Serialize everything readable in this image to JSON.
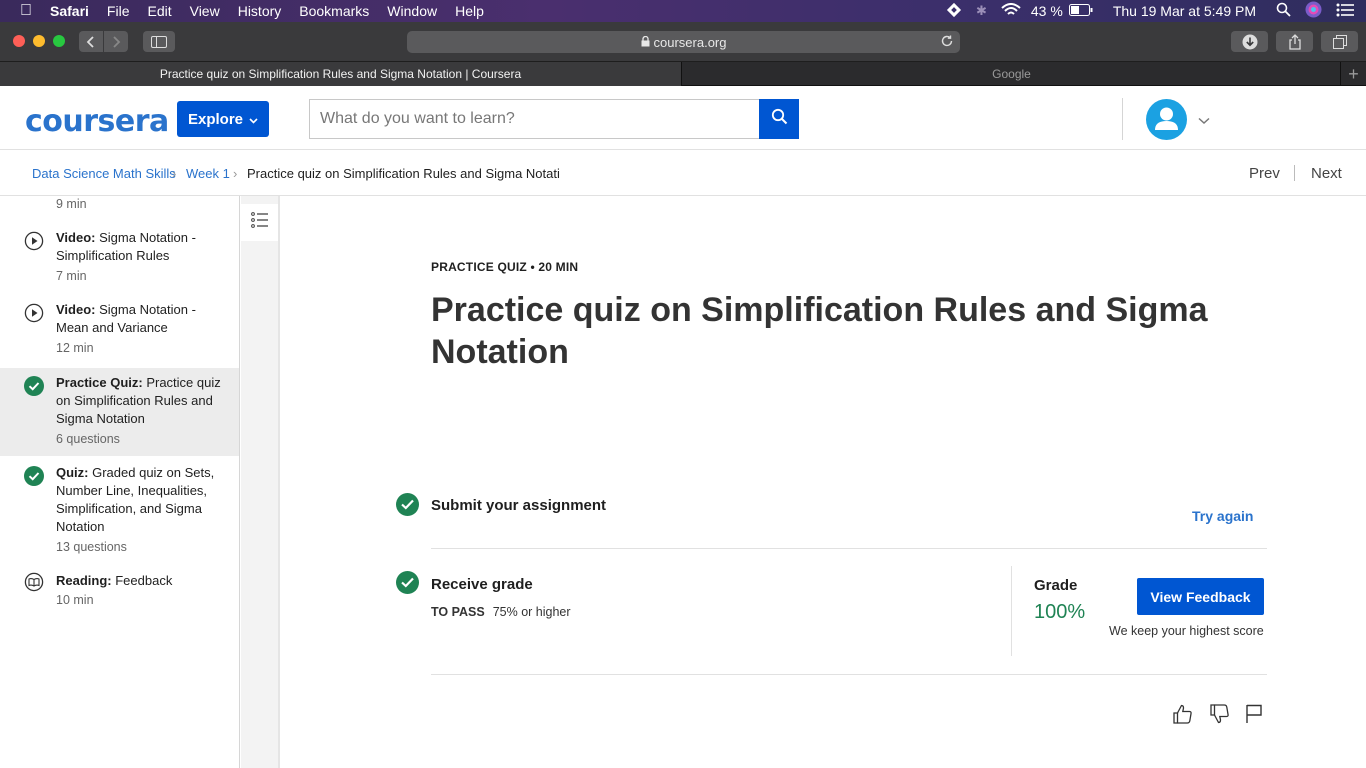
{
  "menubar": {
    "app": "Safari",
    "items": [
      "File",
      "Edit",
      "View",
      "History",
      "Bookmarks",
      "Window",
      "Help"
    ],
    "battery": "43 %",
    "datetime": "Thu 19 Mar at  5:49 PM"
  },
  "browser": {
    "url": "coursera.org",
    "tabs": [
      {
        "label": "Practice quiz on Simplification Rules and Sigma Notation | Coursera",
        "active": true
      },
      {
        "label": "Google",
        "active": false
      }
    ]
  },
  "header": {
    "logo": "coursera",
    "explore_label": "Explore",
    "search_placeholder": "What do you want to learn?"
  },
  "breadcrumb": {
    "items": [
      "Data Science Math Skills",
      "Week 1",
      "Practice quiz on Simplification Rules and Sigma Notati"
    ],
    "prev": "Prev",
    "next": "Next"
  },
  "sidebar": {
    "items": [
      {
        "type": "",
        "title": "",
        "meta": "9 min",
        "icon": "none"
      },
      {
        "type": "Video:",
        "title": " Sigma Notation - Simplification Rules",
        "meta": "7 min",
        "icon": "play-circle-icon"
      },
      {
        "type": "Video:",
        "title": " Sigma Notation - Mean and Variance",
        "meta": "12 min",
        "icon": "play-circle-icon"
      },
      {
        "type": "Practice Quiz:",
        "title": " Practice quiz on Simplification Rules and Sigma Notation",
        "meta": "6 questions",
        "icon": "check-circle-icon",
        "selected": true
      },
      {
        "type": "Quiz:",
        "title": " Graded quiz on Sets, Number Line, Inequalities, Simplification, and Sigma Notation",
        "meta": "13 questions",
        "icon": "check-circle-icon"
      },
      {
        "type": "Reading:",
        "title": " Feedback",
        "meta": "10 min",
        "icon": "book-icon"
      }
    ]
  },
  "main": {
    "eyebrow": "PRACTICE QUIZ • 20 MIN",
    "title": "Practice quiz on Simplification Rules and Sigma Notation",
    "submit": {
      "label": "Submit your assignment",
      "action": "Try again"
    },
    "receive": {
      "label": "Receive grade",
      "to_pass_label": "TO PASS",
      "to_pass_value": "75% or higher",
      "grade_label": "Grade",
      "grade_value": "100%",
      "view_feedback": "View Feedback",
      "note": "We keep your highest score"
    }
  },
  "colors": {
    "brand_blue": "#0056d2",
    "link_blue": "#2a73cc",
    "success_green": "#1f8354"
  }
}
